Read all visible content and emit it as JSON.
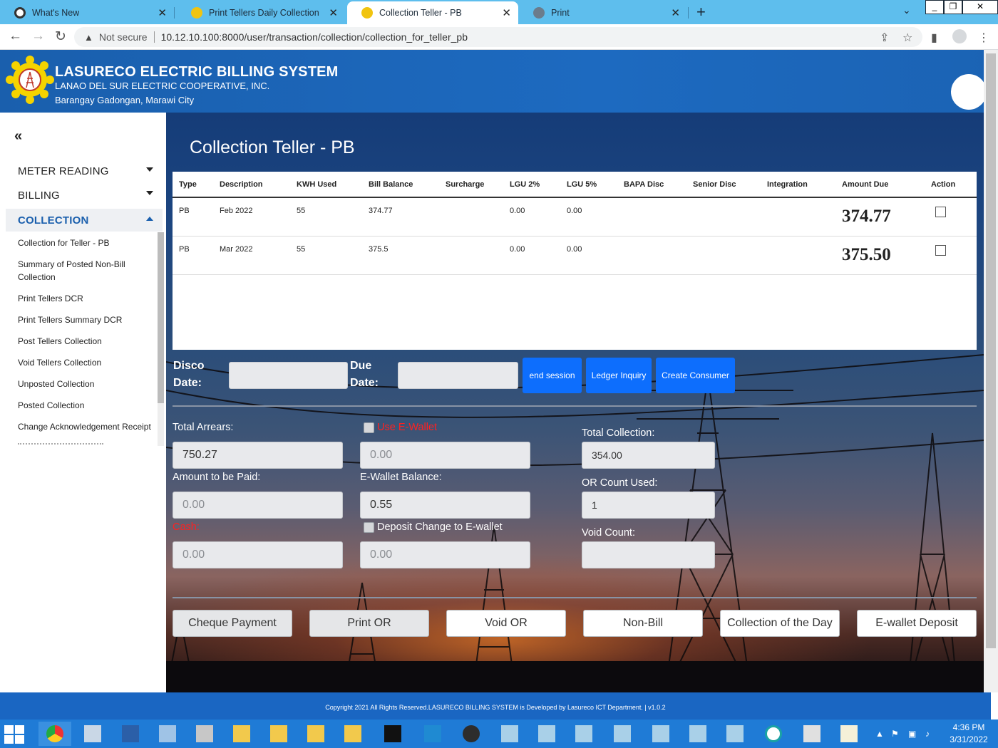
{
  "browser": {
    "tabs": [
      {
        "label": "What's New"
      },
      {
        "label": "Print Tellers Daily Collection"
      },
      {
        "label": "Collection Teller - PB"
      },
      {
        "label": "Print"
      }
    ],
    "not_secure": "Not secure",
    "url": "10.12.10.100:8000/user/transaction/collection/collection_for_teller_pb"
  },
  "header": {
    "title": "LASURECO ELECTRIC BILLING SYSTEM",
    "subtitle": "LANAO DEL SUR ELECTRIC COOPERATIVE, INC.",
    "address": "Barangay Gadongan, Marawi City"
  },
  "sidebar": {
    "collapse_icon": "«",
    "menus": [
      {
        "label": "METER READING"
      },
      {
        "label": "BILLING"
      },
      {
        "label": "COLLECTION"
      }
    ],
    "submenu": [
      {
        "label": "Collection for Teller - PB"
      },
      {
        "label": "Summary of Posted Non-Bill Collection"
      },
      {
        "label": "Print Tellers DCR"
      },
      {
        "label": "Print Tellers Summary DCR"
      },
      {
        "label": "Post Tellers Collection"
      },
      {
        "label": "Void Tellers Collection"
      },
      {
        "label": "Unposted Collection"
      },
      {
        "label": "Posted Collection"
      },
      {
        "label": "Change Acknowledgement Receipt"
      }
    ]
  },
  "main": {
    "title": "Collection Teller - PB",
    "table": {
      "headers": [
        "Type",
        "Description",
        "KWH Used",
        "Bill Balance",
        "Surcharge",
        "LGU 2%",
        "LGU 5%",
        "BAPA Disc",
        "Senior Disc",
        "Integration",
        "Amount Due",
        "Action"
      ],
      "rows": [
        {
          "type": "PB",
          "description": "Feb 2022",
          "kwh": "55",
          "bill_balance": "374.77",
          "surcharge": "",
          "lgu2": "0.00",
          "lgu5": "0.00",
          "bapa": "",
          "senior": "",
          "integration": "",
          "amount_due": "374.77"
        },
        {
          "type": "PB",
          "description": "Mar 2022",
          "kwh": "55",
          "bill_balance": "375.5",
          "surcharge": "",
          "lgu2": "0.00",
          "lgu5": "0.00",
          "bapa": "",
          "senior": "",
          "integration": "",
          "amount_due": "375.50"
        }
      ]
    },
    "disco_date_label": "Disco Date:",
    "due_date_label": "Due Date:",
    "buttons": {
      "end_session": "end session",
      "ledger_inquiry": "Ledger Inquiry",
      "create_consumer": "Create Consumer"
    },
    "form": {
      "total_arrears_label": "Total Arrears:",
      "total_arrears": "750.27",
      "use_ewallet_label": "Use E-Wallet",
      "ewallet_amount": "0.00",
      "total_collection_label": "Total Collection:",
      "total_collection": "354.00",
      "amount_to_be_paid_label": "Amount to be Paid:",
      "amount_to_be_paid_placeholder": "0.00",
      "ewallet_balance_label": "E-Wallet Balance:",
      "ewallet_balance": "0.55",
      "or_count_used_label": "OR Count Used:",
      "or_count_used": "1",
      "cash_label": "Cash:",
      "cash_placeholder": "0.00",
      "deposit_change_label": "Deposit Change to E-wallet",
      "deposit_change_amount": "0.00",
      "void_count_label": "Void Count:",
      "void_count": ""
    },
    "actions": [
      {
        "label": "Cheque Payment"
      },
      {
        "label": "Print OR"
      },
      {
        "label": "Void OR"
      },
      {
        "label": "Non-Bill"
      },
      {
        "label": "Collection of the Day"
      },
      {
        "label": "E-wallet Deposit"
      }
    ]
  },
  "footer": {
    "text": "Copyright 2021 All Rights Reserved.LASURECO BILLING SYSTEM is Developed by Lasureco ICT Department. | v1.0.2"
  },
  "taskbar": {
    "time": "4:36 PM",
    "date": "3/31/2022"
  },
  "colors": {
    "header_blue": "#1a5fad",
    "primary_button": "#0d6efd",
    "collection_active": "#1a5fad",
    "alert_red": "#ff2020"
  }
}
